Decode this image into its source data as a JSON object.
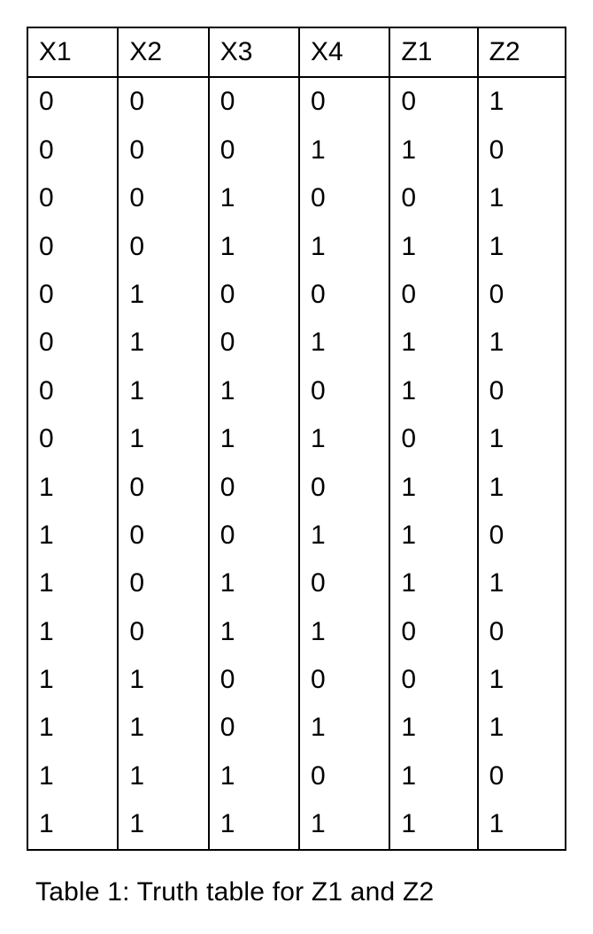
{
  "chart_data": {
    "type": "table",
    "headers": [
      "X1",
      "X2",
      "X3",
      "X4",
      "Z1",
      "Z2"
    ],
    "rows": [
      [
        "0",
        "0",
        "0",
        "0",
        "0",
        "1"
      ],
      [
        "0",
        "0",
        "0",
        "1",
        "1",
        "0"
      ],
      [
        "0",
        "0",
        "1",
        "0",
        "0",
        "1"
      ],
      [
        "0",
        "0",
        "1",
        "1",
        "1",
        "1"
      ],
      [
        "0",
        "1",
        "0",
        "0",
        "0",
        "0"
      ],
      [
        "0",
        "1",
        "0",
        "1",
        "1",
        "1"
      ],
      [
        "0",
        "1",
        "1",
        "0",
        "1",
        "0"
      ],
      [
        "0",
        "1",
        "1",
        "1",
        "0",
        "1"
      ],
      [
        "1",
        "0",
        "0",
        "0",
        "1",
        "1"
      ],
      [
        "1",
        "0",
        "0",
        "1",
        "1",
        "0"
      ],
      [
        "1",
        "0",
        "1",
        "0",
        "1",
        "1"
      ],
      [
        "1",
        "0",
        "1",
        "1",
        "0",
        "0"
      ],
      [
        "1",
        "1",
        "0",
        "0",
        "0",
        "1"
      ],
      [
        "1",
        "1",
        "0",
        "1",
        "1",
        "1"
      ],
      [
        "1",
        "1",
        "1",
        "0",
        "1",
        "0"
      ],
      [
        "1",
        "1",
        "1",
        "1",
        "1",
        "1"
      ]
    ],
    "caption": "Table 1: Truth table for Z1 and Z2"
  }
}
